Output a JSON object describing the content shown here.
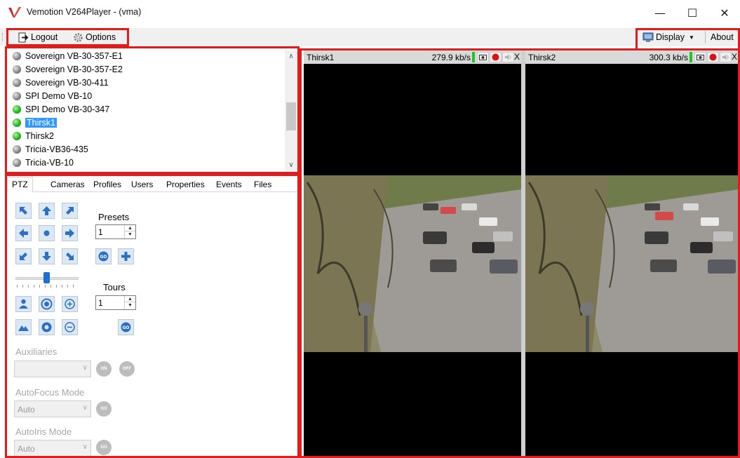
{
  "window": {
    "title": "Vemotion V264Player - (vma)",
    "minimize_glyph": "—",
    "maximize_glyph": "☐",
    "close_glyph": "✕"
  },
  "toolbar": {
    "logout_label": "Logout",
    "options_label": "Options",
    "display_label": "Display",
    "about_label": "About"
  },
  "cameras": [
    {
      "name": "Sovereign VB-30-357-E1",
      "status": "offline"
    },
    {
      "name": "Sovereign VB-30-357-E2",
      "status": "offline"
    },
    {
      "name": "Sovereign VB-30-411",
      "status": "offline"
    },
    {
      "name": "SPI Demo VB-10",
      "status": "offline"
    },
    {
      "name": "SPI Demo VB-30-347",
      "status": "online"
    },
    {
      "name": "Thirsk1",
      "status": "online",
      "selected": true
    },
    {
      "name": "Thirsk2",
      "status": "online"
    },
    {
      "name": "Tricia-VB36-435",
      "status": "offline"
    },
    {
      "name": "Tricia-VB-10",
      "status": "offline"
    }
  ],
  "tabs": [
    "PTZ",
    "Cameras",
    "Profiles",
    "Users",
    "Properties",
    "Events",
    "Files"
  ],
  "active_tab": "PTZ",
  "ptz": {
    "presets_label": "Presets",
    "presets_value": "1",
    "tours_label": "Tours",
    "tours_value": "1",
    "go_text": "GO",
    "auxiliaries_label": "Auxiliaries",
    "auxiliaries_value": "",
    "on_text": "ON",
    "off_text": "OFF",
    "autofocus_label": "AutoFocus Mode",
    "autofocus_value": "Auto",
    "autoiris_label": "AutoIris Mode",
    "autoiris_value": "Auto"
  },
  "videos": [
    {
      "name": "Thirsk1",
      "bitrate": "279.9 kb/s",
      "close": "X"
    },
    {
      "name": "Thirsk2",
      "bitrate": "300.3 kb/s",
      "close": "X"
    }
  ],
  "colors": {
    "highlight_box": "#e31b1b",
    "selection": "#3399ff",
    "online": "#2bbf2b",
    "offline": "#8a8a8a"
  }
}
